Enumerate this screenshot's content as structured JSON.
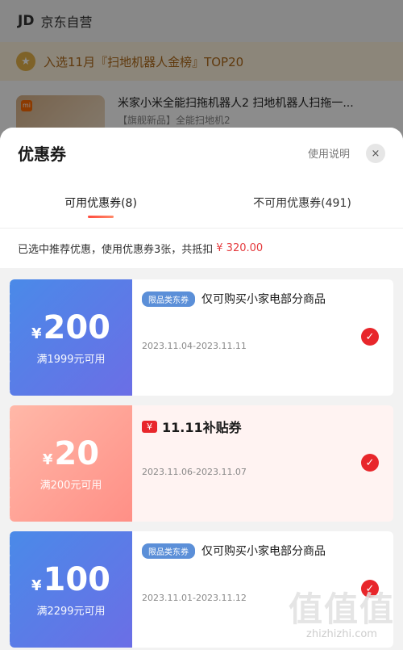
{
  "background": {
    "logo": "JD",
    "shop_name": "京东自营",
    "rank_badge": "入选11月『扫地机器人金榜』TOP20",
    "product_title": "米家小米全能扫拖机器人2 扫地机器人扫拖一...",
    "product_sub": "【旗舰新品】全能扫地机2"
  },
  "sheet": {
    "title": "优惠券",
    "usage_link": "使用说明",
    "close_icon": "×"
  },
  "tabs": [
    {
      "label": "可用优惠券(8)",
      "active": true
    },
    {
      "label": "不可用优惠券(491)",
      "active": false
    }
  ],
  "summary": {
    "text": "已选中推荐优惠，使用优惠券3张，共抵扣",
    "amount": "¥ 320.00"
  },
  "coupons": [
    {
      "amount": "200",
      "currency": "¥",
      "condition": "满1999元可用",
      "tag": "限品类东券",
      "title": "仅可购买小家电部分商品",
      "date": "2023.11.04-2023.11.11",
      "selected": true
    },
    {
      "amount": "20",
      "currency": "¥",
      "condition": "满200元可用",
      "badge_symbol": "¥",
      "title": "11.11补贴券",
      "date": "2023.11.06-2023.11.07",
      "selected": true
    },
    {
      "amount": "100",
      "currency": "¥",
      "condition": "满2299元可用",
      "tag": "限品类东券",
      "title": "仅可购买小家电部分商品",
      "date": "2023.11.01-2023.11.12",
      "selected": true
    }
  ],
  "watermark": {
    "big": "值值值",
    "small": "zhizhizhi.com"
  },
  "colors": {
    "accent_red": "#e8262b",
    "coupon_blue": "#4a8ae8",
    "coupon_pink": "#ff8f86"
  }
}
